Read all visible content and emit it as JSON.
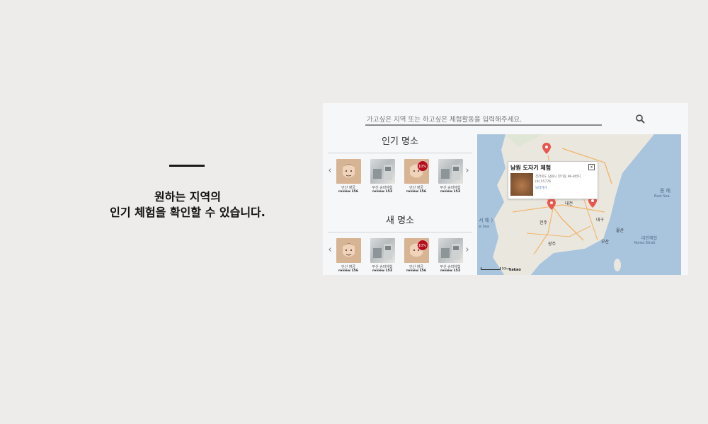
{
  "hero": {
    "line1": "원하는 지역의",
    "line2": "인기 체험을 확인할 수 있습니다."
  },
  "search": {
    "placeholder": "가고싶은 지역 또는 하고싶은 체험활동을 입력해주세요.",
    "icon": "search-icon"
  },
  "sections": [
    {
      "title": "인기 명소",
      "cards": [
        {
          "name": "안산 향궁",
          "review": "review 156",
          "thumb": "face",
          "badge": ""
        },
        {
          "name": "부산 숭마체험",
          "review": "review 153",
          "thumb": "workshop",
          "badge": ""
        },
        {
          "name": "안산 향궁",
          "review": "review 156",
          "thumb": "face",
          "badge": "10%"
        },
        {
          "name": "부산 숭마체험",
          "review": "review 153",
          "thumb": "workshop",
          "badge": ""
        }
      ]
    },
    {
      "title": "새 명소",
      "cards": [
        {
          "name": "안산 향궁",
          "review": "review 156",
          "thumb": "face",
          "badge": ""
        },
        {
          "name": "부산 숭마체험",
          "review": "review 153",
          "thumb": "workshop",
          "badge": ""
        },
        {
          "name": "안산 향궁",
          "review": "review 156",
          "thumb": "face",
          "badge": "10%"
        },
        {
          "name": "부산 숭마체험",
          "review": "review 153",
          "thumb": "workshop",
          "badge": ""
        }
      ]
    }
  ],
  "map": {
    "popup": {
      "title": "남원 도자기 체험",
      "close": "x",
      "address": "전라북도 남원시 한가동 96-8번지",
      "phone": "(9) 55776",
      "link": "보러가기"
    },
    "labels": {
      "east_sea": "동 해",
      "east_sea_en": "East Sea",
      "korea_strait": "대한해협",
      "korea_strait_en": "Korea Strait",
      "yellow_sea": "서 해 )",
      "yellow_sea_en": "w Sea",
      "daejeon": "대전",
      "daegu": "대구",
      "ulsan": "울산",
      "gwangju": "광주",
      "busan": "부산",
      "jeonju": "전주"
    },
    "scale": "50km",
    "brand": "kakao",
    "marker_color": "#e8574d"
  }
}
